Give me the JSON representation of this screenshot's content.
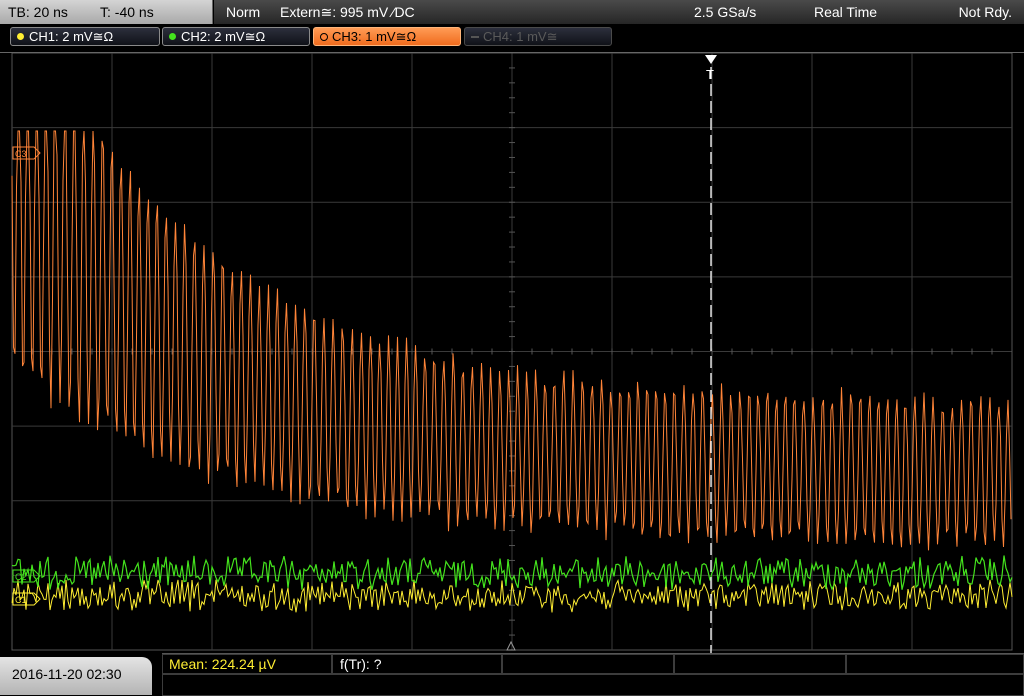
{
  "header": {
    "timebase": "TB: 20 ns",
    "trigger_offset": "T: -40 ns",
    "trigger_mode": "Norm",
    "trigger_source": "Extern≅: 995 mV ⁄DC",
    "sample_rate": "2.5 GSa/s",
    "acq_mode": "Real Time",
    "run_state": "Not Rdy."
  },
  "channels": [
    {
      "label": "CH1: 2 mV≅Ω",
      "color": "#ffee33",
      "state": "on"
    },
    {
      "label": "CH2: 2 mV≅Ω",
      "color": "#44e31d",
      "state": "on"
    },
    {
      "label": "CH3: 1 mV≅Ω",
      "color": "#ff8438",
      "state": "active"
    },
    {
      "label": "CH4: 1 mV≅",
      "color": "#6a6a6a",
      "state": "off"
    }
  ],
  "markers": {
    "ch3": "C3",
    "ch2": "C2",
    "ch1": "C1",
    "trigger": "T"
  },
  "footer": {
    "datetime": "2016-11-20 02:30",
    "mean_label": "Mean: 224.24 µV",
    "ftr_label": "f(Tr): ?"
  },
  "colors": {
    "grid": "#3a3a3a",
    "ch1": "#ffee33",
    "ch2": "#44e31d",
    "ch3": "#ff8438",
    "measure_text": "#ffee33"
  }
}
